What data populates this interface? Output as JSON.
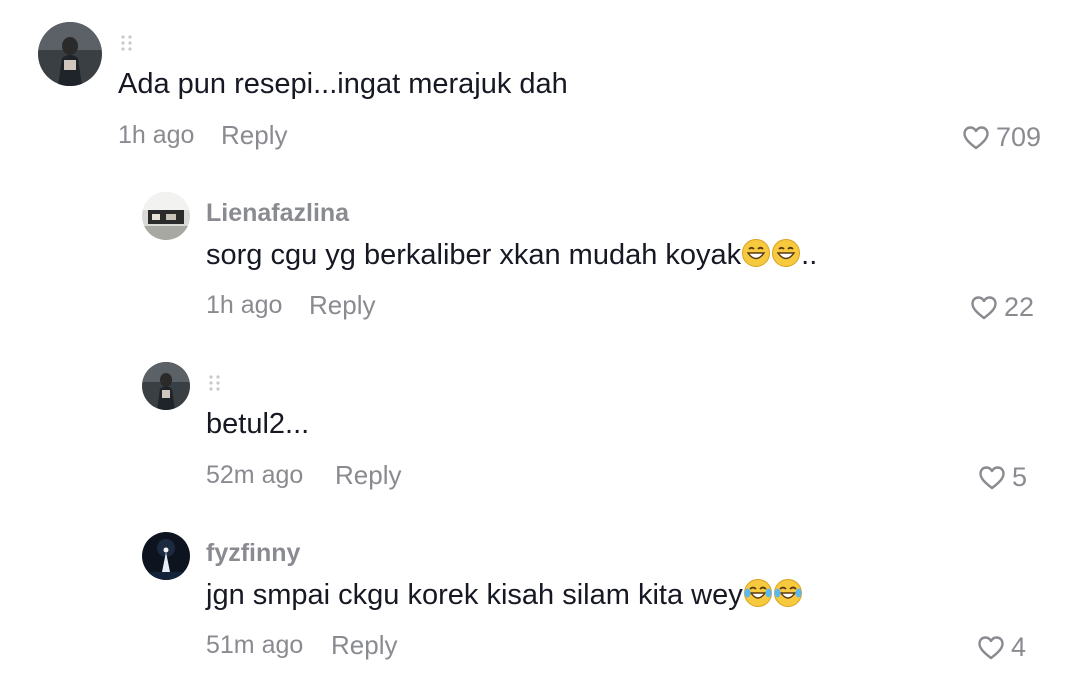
{
  "comments": [
    {
      "username": "",
      "text": "Ada pun resepi...ingat merajuk dah",
      "time": "1h ago",
      "reply_label": "Reply",
      "likes": "709"
    },
    {
      "username": "Lienafazlina",
      "text": "sorg cgu yg berkaliber xkan mudah koyak",
      "text_suffix": "..",
      "emoji": [
        "grinning-face-with-smiling-eyes",
        "grinning-face-with-smiling-eyes"
      ],
      "time": "1h ago",
      "reply_label": "Reply",
      "likes": "22"
    },
    {
      "username": "",
      "text": "betul2...",
      "time": "52m ago",
      "reply_label": "Reply",
      "likes": "5"
    },
    {
      "username": "fyzfinny",
      "text": "jgn smpai ckgu korek kisah silam kita wey",
      "emoji": [
        "face-with-tears-of-joy",
        "face-with-tears-of-joy"
      ],
      "time": "51m ago",
      "reply_label": "Reply",
      "likes": "4"
    }
  ],
  "colors": {
    "text": "#161823",
    "secondary": "#8a8b91",
    "background": "#ffffff"
  },
  "icons": [
    "heart-outline-icon",
    "more-dots-icon",
    "avatar-photo"
  ]
}
